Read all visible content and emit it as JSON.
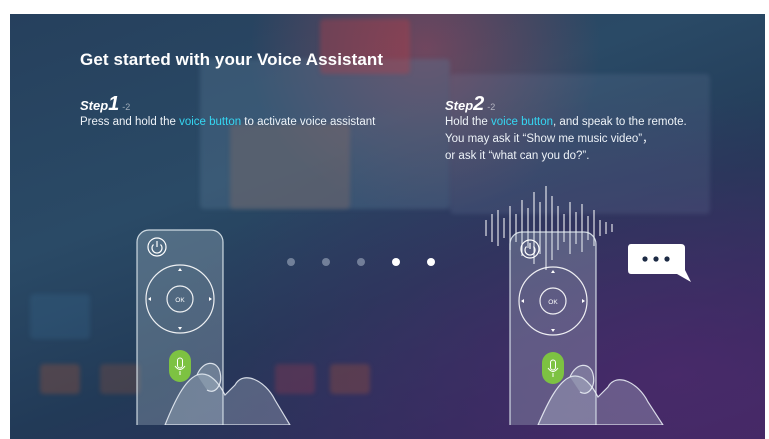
{
  "title": "Get started with your Voice Assistant",
  "steps": [
    {
      "label": "Step",
      "number": "1",
      "of": "-2",
      "text_before": "Press and hold the ",
      "highlight": "voice button",
      "text_after": " to activate voice assistant"
    },
    {
      "label": "Step",
      "number": "2",
      "of": "-2",
      "text_before": "Hold the ",
      "highlight": "voice button",
      "text_after": ", and speak to the remote.",
      "line2": "You may ask it “Show me music video”，",
      "line3": "or ask it “what can you do?”."
    }
  ],
  "remote": {
    "ok_label": "OK"
  },
  "pagination": {
    "count": 5,
    "current": 4
  },
  "colors": {
    "highlight": "#35d6f2",
    "voice_button": "#7dc242"
  },
  "icons": [
    "power-icon",
    "microphone-icon",
    "chat-bubble-icon",
    "sound-wave-icon"
  ]
}
